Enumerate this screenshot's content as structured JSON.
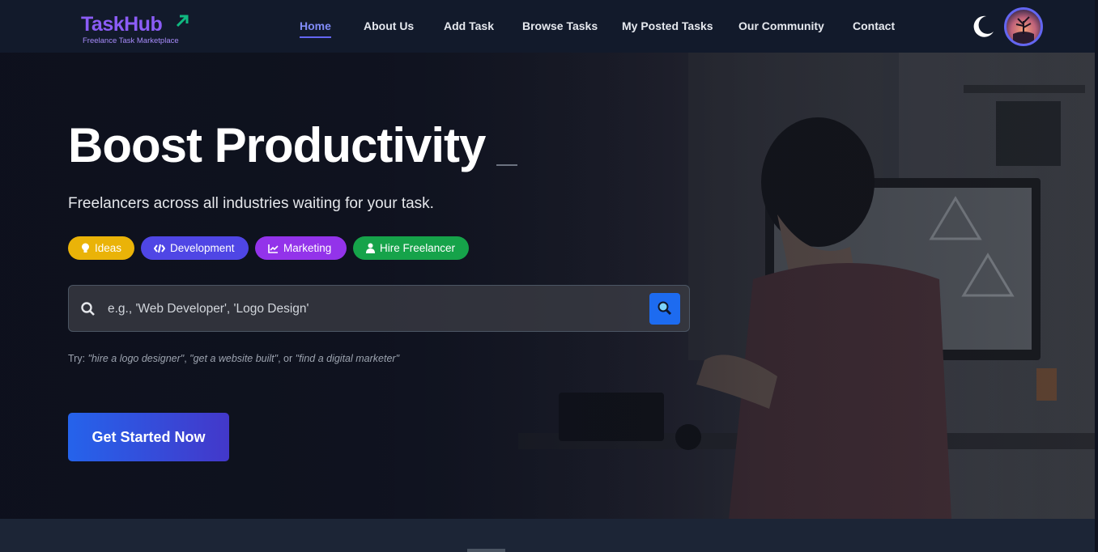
{
  "brand": {
    "name": "TaskHub",
    "tagline": "Freelance Task Marketplace",
    "accent": "#8b5cf6"
  },
  "nav": {
    "items": [
      {
        "label": "Home",
        "active": true
      },
      {
        "label": "About Us",
        "active": false
      },
      {
        "label": "Add Task",
        "active": false
      },
      {
        "label": "Browse Tasks",
        "active": false
      },
      {
        "label": "My Posted Tasks",
        "active": false
      },
      {
        "label": "Our Community",
        "active": false
      },
      {
        "label": "Contact",
        "active": false
      }
    ],
    "theme_toggle_icon": "moon-icon"
  },
  "hero": {
    "title": "Boost Productivity",
    "subtitle": "Freelancers across all industries waiting for your task.",
    "chips": [
      {
        "label": "Ideas",
        "icon": "lightbulb-icon",
        "color": "#eab308"
      },
      {
        "label": "Development",
        "icon": "code-icon",
        "color": "#4f46e5"
      },
      {
        "label": "Marketing",
        "icon": "chart-line-icon",
        "color": "#9333ea"
      },
      {
        "label": "Hire Freelancer",
        "icon": "user-tie-icon",
        "color": "#16a34a"
      }
    ],
    "search": {
      "placeholder": "e.g., 'Web Developer', 'Logo Design'",
      "value": ""
    },
    "try": {
      "prefix": "Try: ",
      "example1": "\"hire a logo designer\"",
      "sep1": ", ",
      "example2": "\"get a website built\"",
      "sep2": ", or ",
      "example3": "\"find a digital marketer\""
    },
    "cta_label": "Get Started Now"
  }
}
